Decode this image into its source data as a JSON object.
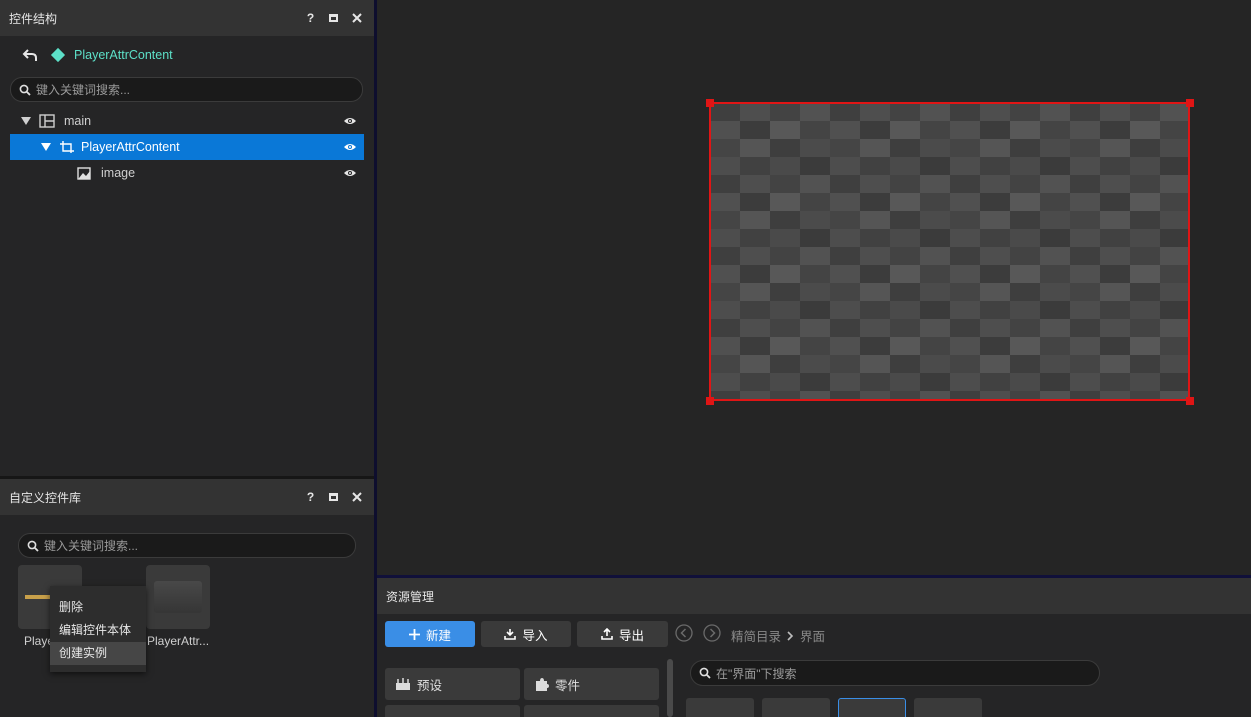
{
  "hierarchy_panel": {
    "title": "控件结构",
    "help": "?",
    "root_name": "PlayerAttrContent",
    "search_placeholder": "键入关键词搜索...",
    "tree": [
      {
        "label": "main"
      },
      {
        "label": "PlayerAttrContent"
      },
      {
        "label": "image"
      }
    ]
  },
  "library_panel": {
    "title": "自定义控件库",
    "help": "?",
    "search_placeholder": "键入关键词搜索...",
    "items": [
      {
        "label": "Playe"
      },
      {
        "label": "PlayerAttr..."
      }
    ],
    "context_menu": [
      "删除",
      "编辑控件本体",
      "创建实例"
    ]
  },
  "resource_panel": {
    "title": "资源管理",
    "buttons": {
      "new": "新建",
      "import": "导入",
      "export": "导出"
    },
    "breadcrumb": [
      "精简目录",
      "界面"
    ],
    "categories": [
      "预设",
      "零件"
    ],
    "search_placeholder": "在\"界面\"下搜索"
  },
  "colors": {
    "accent": "#0a78d7",
    "primary_button": "#3a8ee6",
    "selection_box": "#e01515",
    "root_icon": "#5de0c8"
  }
}
